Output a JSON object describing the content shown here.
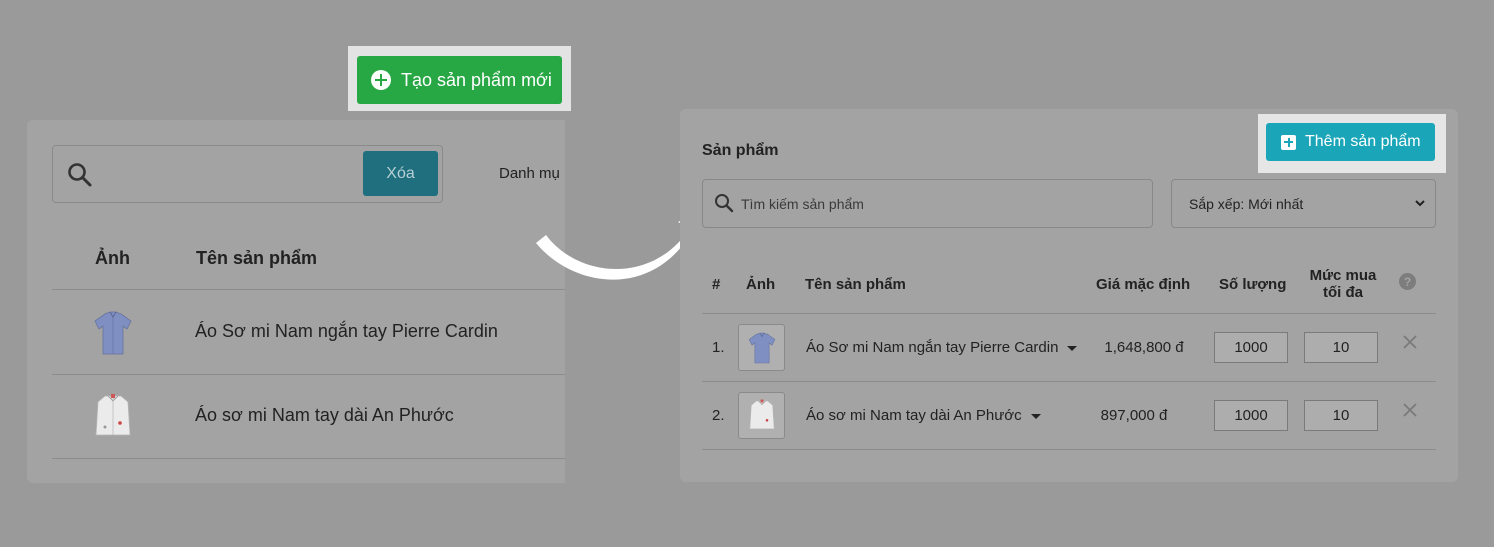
{
  "left": {
    "create_button": "Tạo sản phẩm mới",
    "clear_button": "Xóa",
    "category_label": "Danh mụ",
    "columns": {
      "image": "Ảnh",
      "name": "Tên sản phẩm"
    },
    "products": [
      {
        "name": "Áo Sơ mi Nam ngắn tay Pierre Cardin",
        "thumb": "short-sleeve-shirt"
      },
      {
        "name": "Áo sơ mi Nam tay dài An Phước",
        "thumb": "long-sleeve-shirt"
      }
    ]
  },
  "right": {
    "title": "Sản phẩm",
    "add_button": "Thêm sản phẩm",
    "search_placeholder": "Tìm kiếm sản phẩm",
    "sort_label": "Sắp xếp: Mới nhất",
    "columns": {
      "index": "#",
      "image": "Ảnh",
      "name": "Tên sản phẩm",
      "price": "Giá mặc định",
      "quantity": "Số lượng",
      "max_line1": "Mức mua",
      "max_line2": "tối đa",
      "help": "?"
    },
    "rows": [
      {
        "index": "1.",
        "name": "Áo Sơ mi Nam ngắn tay Pierre Cardin",
        "price": "1,648,800 đ",
        "quantity": "1000",
        "max": "10"
      },
      {
        "index": "2.",
        "name": "Áo sơ mi Nam tay dài An Phước",
        "price": "897,000 đ",
        "quantity": "1000",
        "max": "10"
      }
    ]
  },
  "colors": {
    "background": "#9a9a9a",
    "create_button": "#28a745",
    "add_button": "#1aa5b8",
    "clear_button": "#1f6f7f"
  }
}
